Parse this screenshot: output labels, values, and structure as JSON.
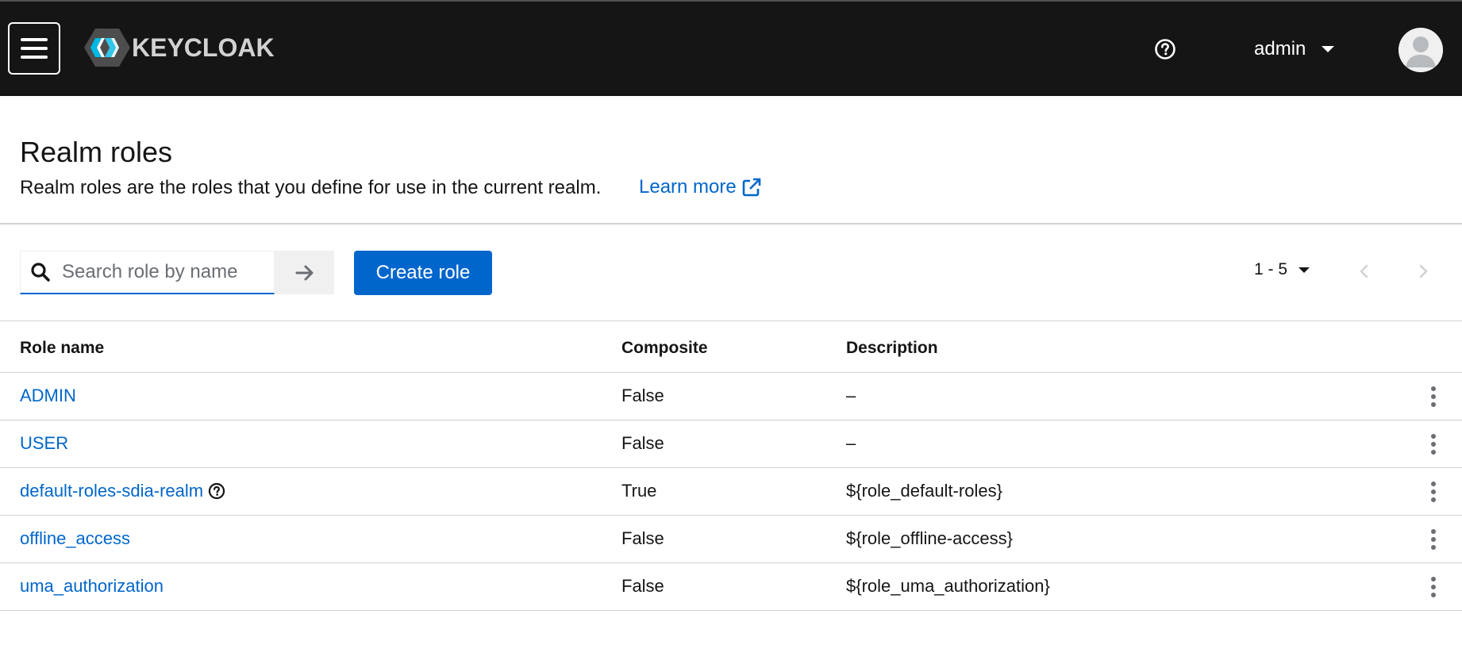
{
  "masthead": {
    "brand": "KEYCLOAK",
    "username": "admin",
    "icons": {
      "menu": "hamburger-icon",
      "help": "question-circle-icon",
      "user": "caret-down-icon",
      "avatar": "user-avatar-icon"
    }
  },
  "page": {
    "title": "Realm roles",
    "description": "Realm roles are the roles that you define for use in the current realm.",
    "learn_more": "Learn more"
  },
  "toolbar": {
    "search_placeholder": "Search role by name",
    "search_value": "",
    "create_label": "Create role",
    "pagination_range": "1 - 5"
  },
  "table": {
    "headers": [
      "Role name",
      "Composite",
      "Description"
    ],
    "rows": [
      {
        "name": "ADMIN",
        "composite": "False",
        "description": "–",
        "help": false
      },
      {
        "name": "USER",
        "composite": "False",
        "description": "–",
        "help": false
      },
      {
        "name": "default-roles-sdia-realm",
        "composite": "True",
        "description": "${role_default-roles}",
        "help": true
      },
      {
        "name": "offline_access",
        "composite": "False",
        "description": "${role_offline-access}",
        "help": false
      },
      {
        "name": "uma_authorization",
        "composite": "False",
        "description": "${role_uma_authorization}",
        "help": false
      }
    ]
  },
  "colors": {
    "masthead_bg": "#151515",
    "link": "#0066cc",
    "primary_button": "#0066cc",
    "border": "#d2d2d2"
  }
}
